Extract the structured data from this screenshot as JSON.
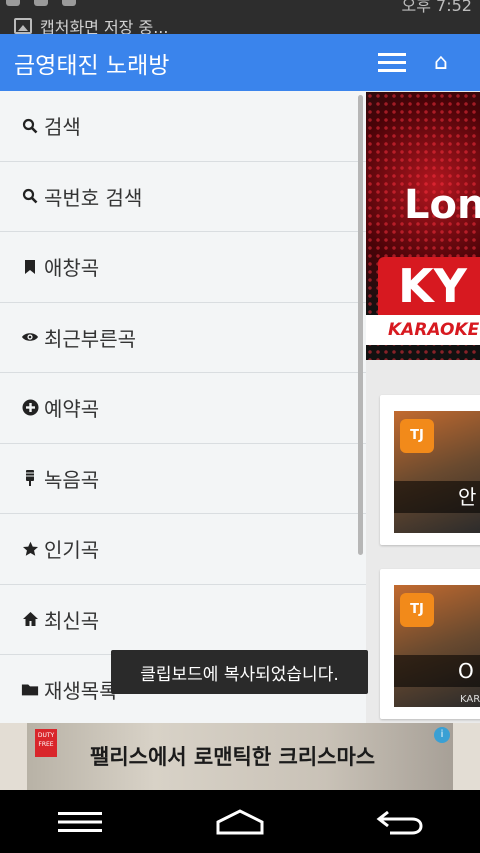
{
  "status_bar": {
    "notification_text": "캡처화면 저장 중...",
    "clock": "오후 7:52"
  },
  "drawer": {
    "title": "금영태진 노래방",
    "items": [
      {
        "label": "검색",
        "icon": "search-icon"
      },
      {
        "label": "곡번호 검색",
        "icon": "search-icon"
      },
      {
        "label": "애창곡",
        "icon": "bookmark-icon"
      },
      {
        "label": "최근부른곡",
        "icon": "eye-icon"
      },
      {
        "label": "예약곡",
        "icon": "plus-circle-icon"
      },
      {
        "label": "녹음곡",
        "icon": "microphone-icon"
      },
      {
        "label": "인기곡",
        "icon": "star-icon"
      },
      {
        "label": "최신곡",
        "icon": "home-icon"
      },
      {
        "label": "재생목록",
        "icon": "folder-icon"
      }
    ]
  },
  "main": {
    "banner_text": "Lon",
    "banner_logo": "KY",
    "banner_strip": "KARAOKE",
    "cards": [
      {
        "badge": "TJ",
        "label": "안"
      },
      {
        "badge": "TJ",
        "label": "O",
        "sublabel": "KARD"
      }
    ]
  },
  "toast": {
    "message": "클립보드에 복사되었습니다."
  },
  "ad": {
    "text": "팰리스에서 로맨틱한 크리스마스",
    "logo_text": "DUTY FREE",
    "tag": "i"
  },
  "colors": {
    "primary": "#3a84ec",
    "drawer_bg": "#f3f5f6",
    "toast_bg": "#2a2a2a"
  }
}
